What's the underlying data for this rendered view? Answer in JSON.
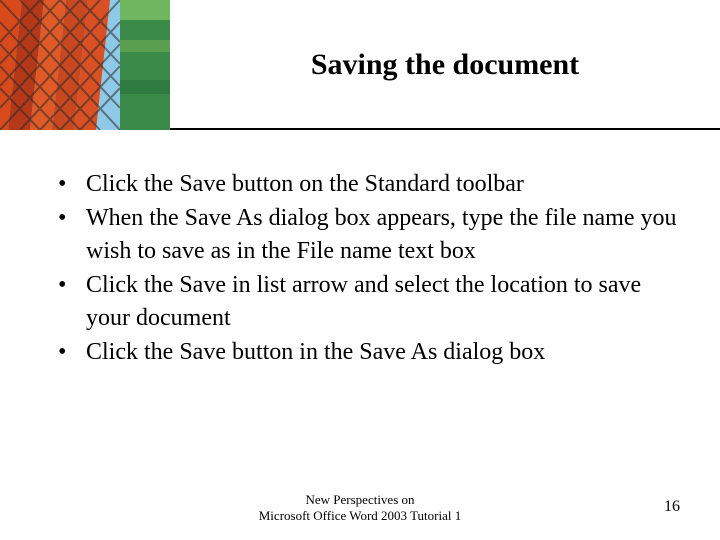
{
  "title": "Saving the document",
  "bullets": [
    "Click the Save button on the Standard toolbar",
    "When the Save As dialog box appears, type the file name you wish to save as in the File name text box",
    "Click the Save in list arrow and select the location to save your document",
    "Click the Save button in the Save As dialog box"
  ],
  "footer": {
    "line1": "New Perspectives on",
    "line2": "Microsoft Office Word 2003 Tutorial 1"
  },
  "page_number": "16"
}
